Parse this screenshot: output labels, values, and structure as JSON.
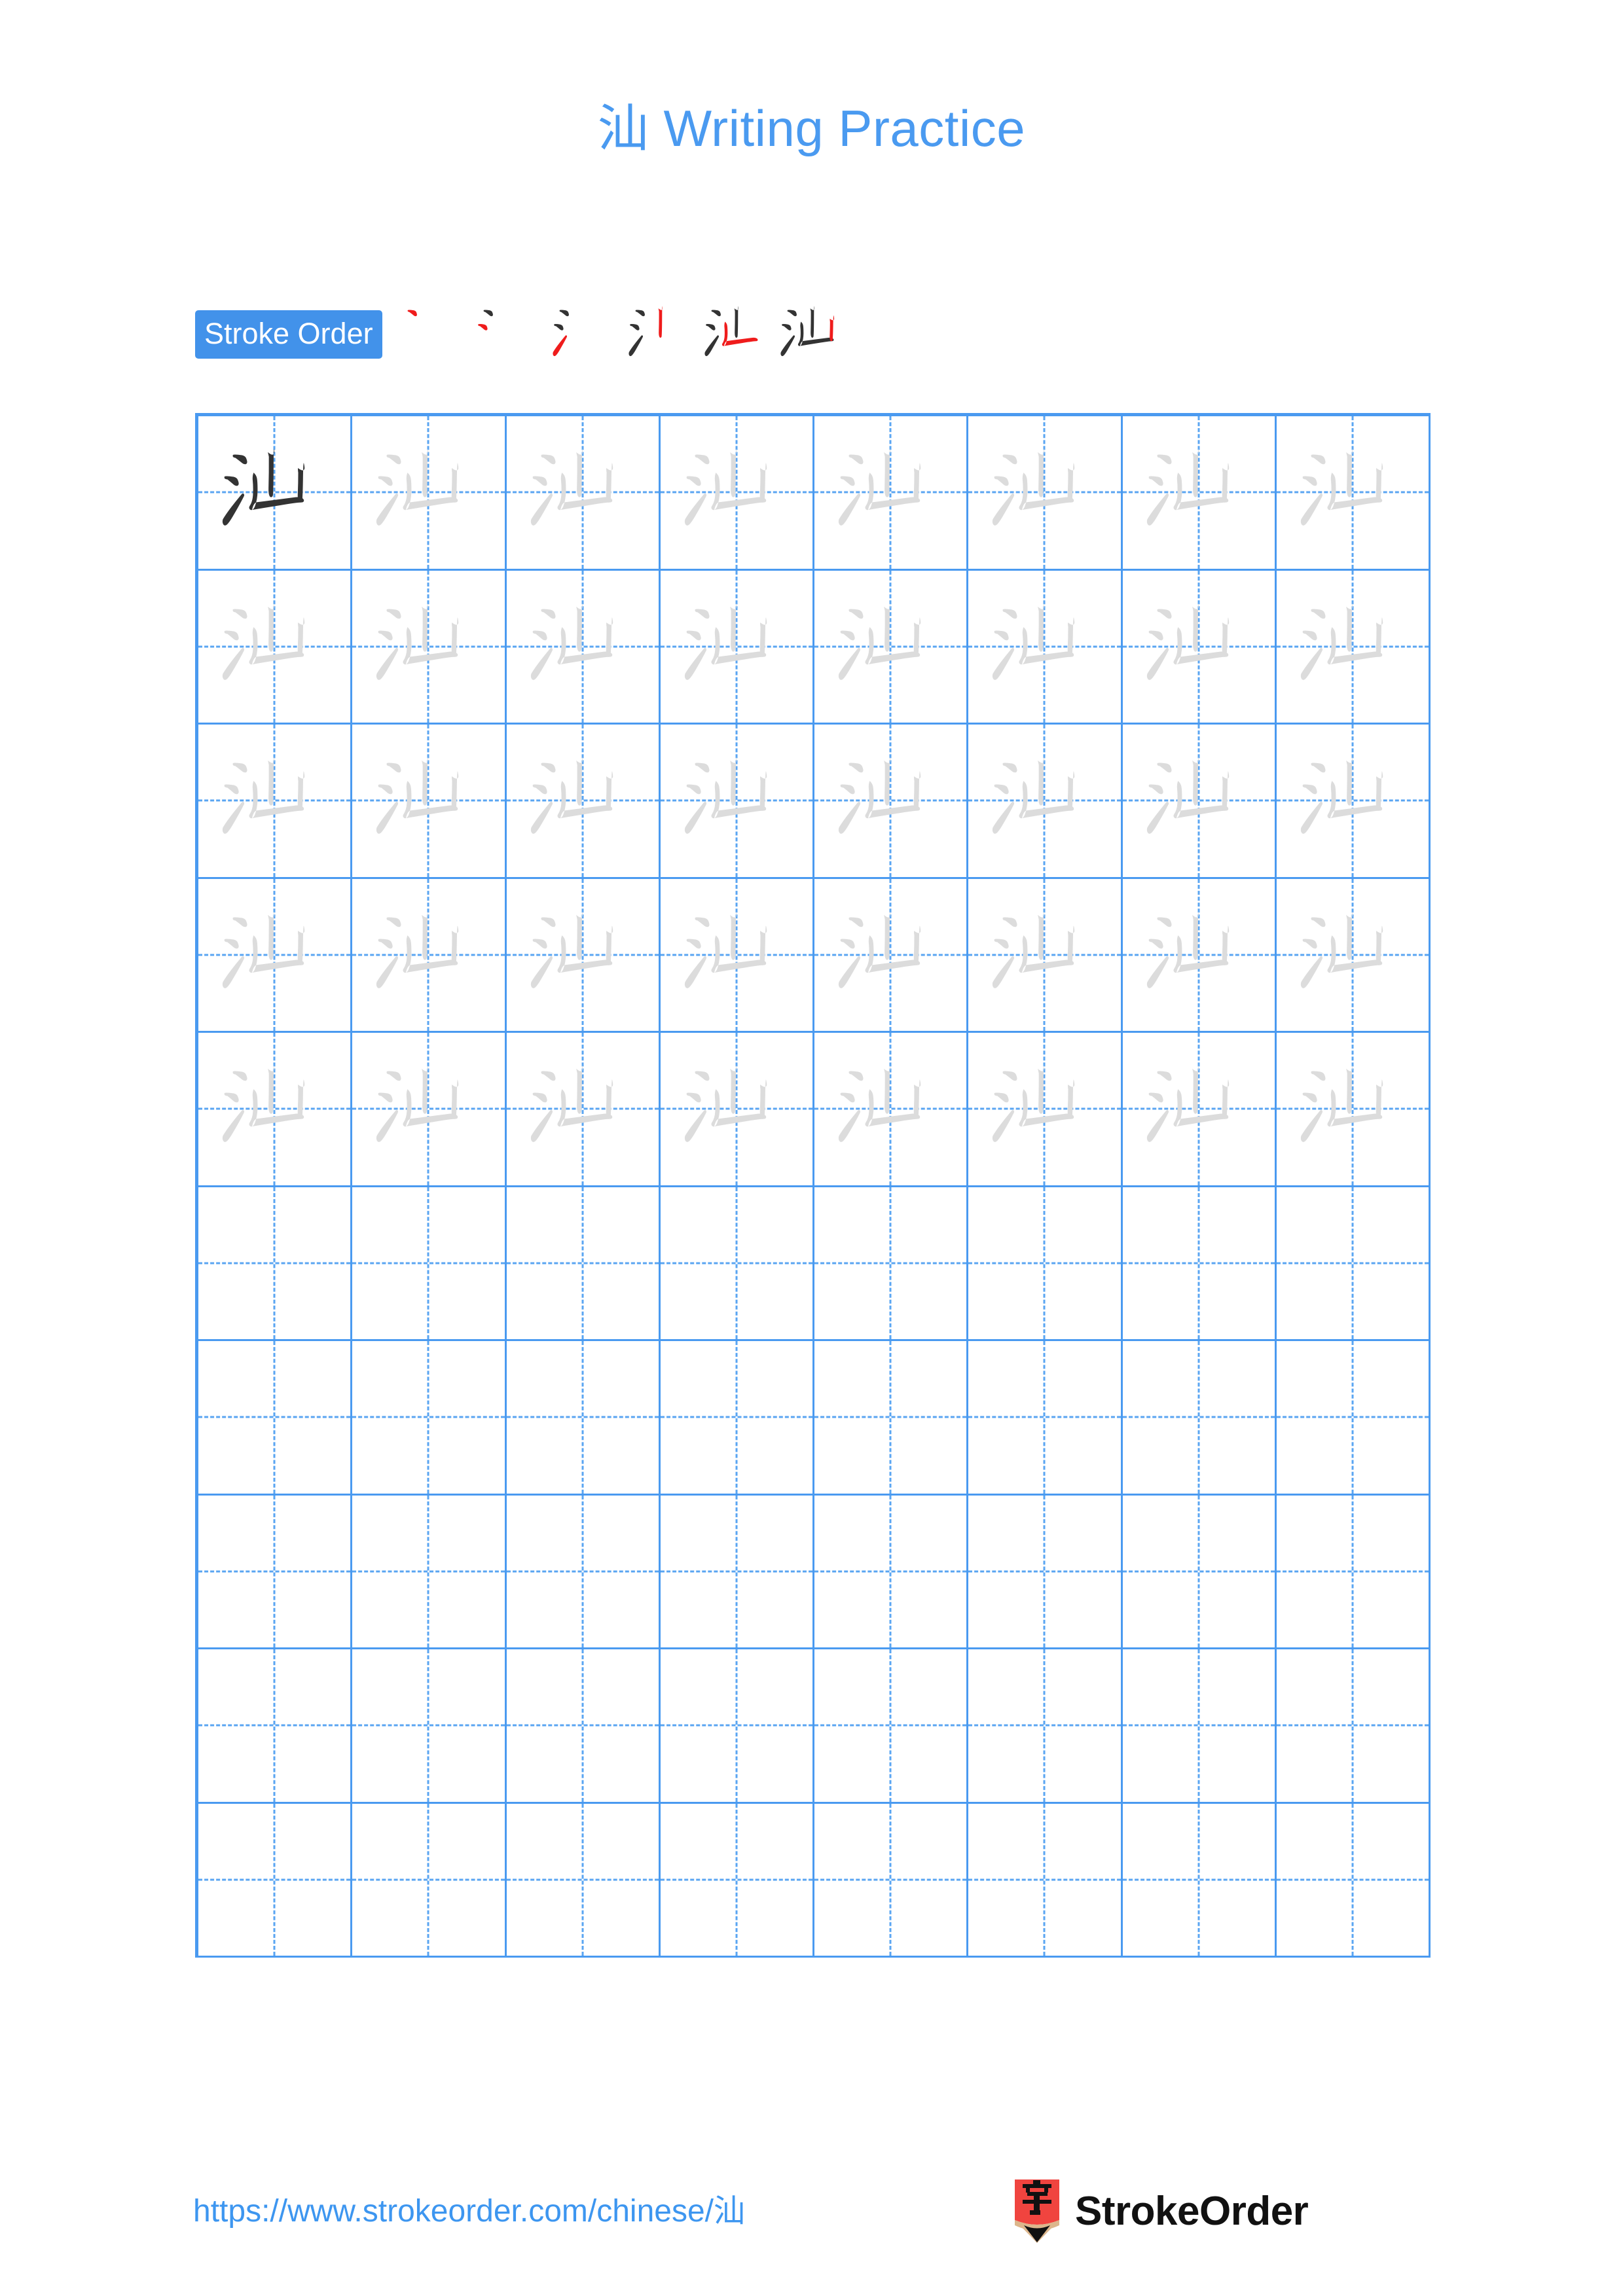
{
  "page": {
    "character": "汕",
    "title": "汕 Writing Practice",
    "title_color": "#4a9af0",
    "background": "#ffffff"
  },
  "stroke_order": {
    "label": "Stroke Order",
    "badge_bg": "#4292ea",
    "badge_text_color": "#ffffff",
    "total_strokes": 6,
    "done_color": "#333333",
    "new_color": "#ef1c1c",
    "steps": [
      {
        "index": 1,
        "new_stroke": "dian-dot-upper",
        "strokes_shown": 1
      },
      {
        "index": 2,
        "new_stroke": "dian-dot-lower",
        "strokes_shown": 2
      },
      {
        "index": 3,
        "new_stroke": "ti-rising",
        "strokes_shown": 3
      },
      {
        "index": 4,
        "new_stroke": "shu-vertical-center",
        "strokes_shown": 4
      },
      {
        "index": 5,
        "new_stroke": "shuzhe-vertical-turn",
        "strokes_shown": 5
      },
      {
        "index": 6,
        "new_stroke": "shu-vertical-right",
        "strokes_shown": 6
      }
    ]
  },
  "grid": {
    "columns": 8,
    "rows": 10,
    "line_color": "#4a9af0",
    "guide_color": "#5aa5f2",
    "traced_rows": 5,
    "empty_rows": 5,
    "model_glyph_color": "#333333",
    "trace_glyph_color": "#dcdcdc"
  },
  "footer": {
    "url": "https://www.strokeorder.com/chinese/汕",
    "url_color": "#3d96f0",
    "brand_name": "StrokeOrder",
    "brand_icon_char": "字",
    "brand_icon_bg": "#f0443f",
    "brand_icon_wood": "#dcb68c",
    "brand_icon_tip": "#111111"
  }
}
